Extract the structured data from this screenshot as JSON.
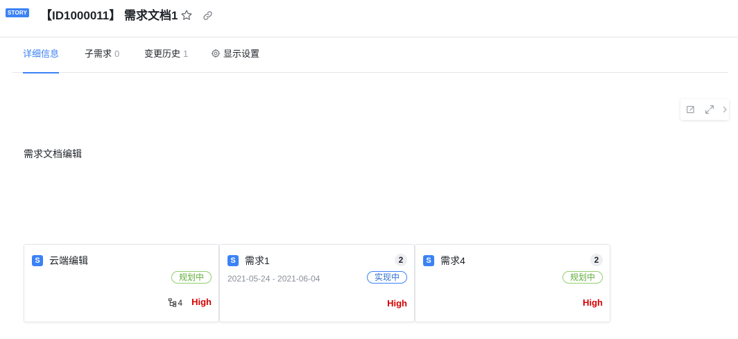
{
  "header": {
    "badge": "STORY",
    "title": "【ID1000011】 需求文档1",
    "icons": [
      "star-icon",
      "link-icon"
    ]
  },
  "tabs": [
    {
      "label": "详细信息",
      "count": "",
      "active": true
    },
    {
      "label": "子需求",
      "count": "0",
      "active": false
    },
    {
      "label": "变更历史",
      "count": "1",
      "active": false
    },
    {
      "label": "显示设置",
      "count": "",
      "active": false,
      "icon": "gear-icon"
    }
  ],
  "tools": [
    "edit-icon",
    "expand-icon",
    "chevron-right-icon"
  ],
  "content": {
    "text": "需求文档编辑"
  },
  "cards": [
    {
      "icon": "S",
      "title": "云端编辑",
      "badge": "",
      "date": "",
      "status": "规划中",
      "status_color": "#5fae3a",
      "subtree": "4",
      "priority": "High"
    },
    {
      "icon": "S",
      "title": "需求1",
      "badge": "2",
      "date": "2021-05-24 - 2021-06-04",
      "status": "实现中",
      "status_color": "#2f6fd0",
      "subtree": "",
      "priority": "High"
    },
    {
      "icon": "S",
      "title": "需求4",
      "badge": "2",
      "date": "",
      "status": "规划中",
      "status_color": "#5fae3a",
      "subtree": "",
      "priority": "High"
    }
  ],
  "colors": {
    "accent": "#3b82f6",
    "priority_high": "#d40000"
  }
}
